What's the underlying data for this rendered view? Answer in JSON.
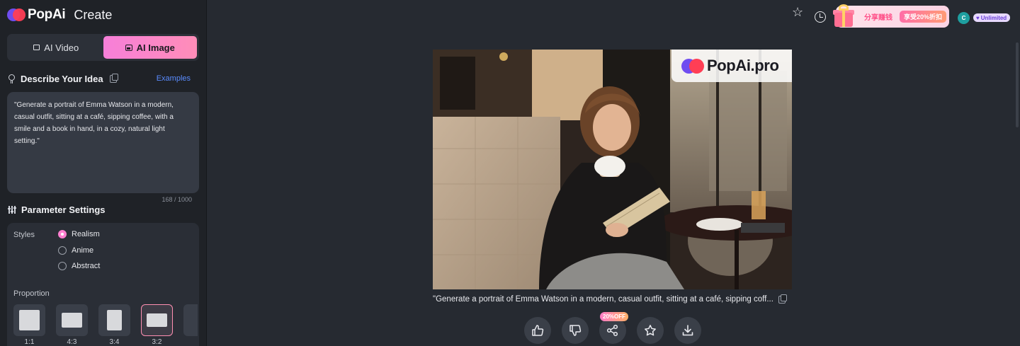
{
  "sidebar": {
    "brand": {
      "logo_text": "PopAi",
      "section": "Create"
    },
    "mode_tabs": [
      {
        "label": "AI Video",
        "active": false
      },
      {
        "label": "AI Image",
        "active": true
      }
    ],
    "describe": {
      "title": "Describe Your Idea",
      "examples_link": "Examples",
      "prompt": "\"Generate a portrait of Emma Watson in a modern, casual outfit, sitting at a café, sipping coffee, with a smile and a book in hand, in a cozy, natural light setting.\"",
      "counter": "168 / 1000"
    },
    "params": {
      "title": "Parameter Settings",
      "styles_label": "Styles",
      "styles": [
        {
          "label": "Realism",
          "selected": true
        },
        {
          "label": "Anime",
          "selected": false
        },
        {
          "label": "Abstract",
          "selected": false
        }
      ],
      "proportion_label": "Proportion",
      "ratios": [
        {
          "label": "1:1",
          "selected": false
        },
        {
          "label": "4:3",
          "selected": false
        },
        {
          "label": "3:4",
          "selected": false
        },
        {
          "label": "3:2",
          "selected": true
        }
      ]
    }
  },
  "header": {
    "promo_text": "分享赚钱",
    "promo_tag": "享受20%折扣",
    "avatar_initial": "C",
    "plan_badge": "Unlimited",
    "icons": [
      "star-icon",
      "history-icon",
      "gift-icon"
    ]
  },
  "result": {
    "watermark": "PopAi.pro",
    "caption": "\"Generate a portrait of Emma Watson in a modern, casual outfit, sitting at a café, sipping coff...",
    "share_badge": "20%OFF",
    "actions": [
      "like",
      "dislike",
      "share",
      "favorite",
      "download"
    ]
  },
  "colors": {
    "accent_pink": "#ff7fd0",
    "link_blue": "#5a8cff",
    "background": "#262a31",
    "sidebar": "#1f2227"
  }
}
